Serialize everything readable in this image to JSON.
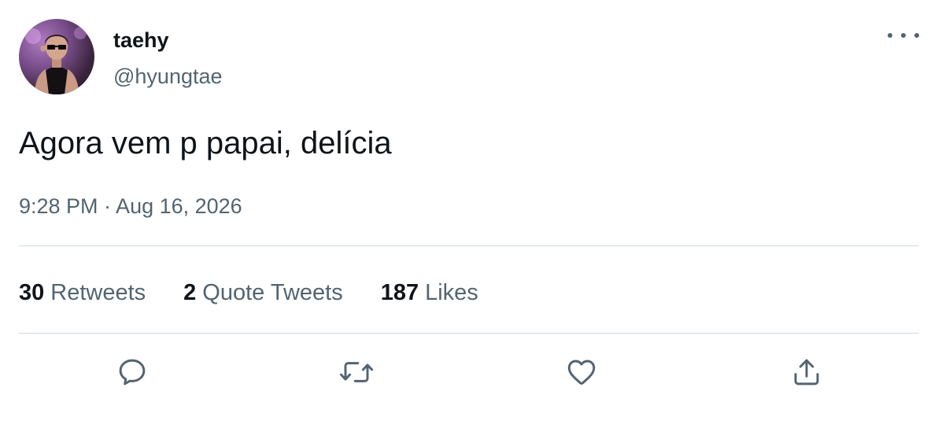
{
  "user": {
    "display_name": "taehy",
    "handle": "@hyungtae",
    "avatar": "profile-photo"
  },
  "tweet": {
    "text": "Agora vem p papai, delícia",
    "timestamp": "9:28 PM · Aug 16, 2026"
  },
  "stats": {
    "retweets_count": "30",
    "retweets_label": "Retweets",
    "quotes_count": "2",
    "quotes_label": "Quote Tweets",
    "likes_count": "187",
    "likes_label": "Likes"
  },
  "actions": [
    {
      "name": "reply",
      "icon": "reply-icon"
    },
    {
      "name": "retweet",
      "icon": "retweet-icon"
    },
    {
      "name": "like",
      "icon": "heart-icon"
    },
    {
      "name": "share",
      "icon": "share-icon"
    }
  ],
  "colors": {
    "text_primary": "#0f1419",
    "text_secondary": "#536471",
    "divider": "#cfd9de"
  }
}
